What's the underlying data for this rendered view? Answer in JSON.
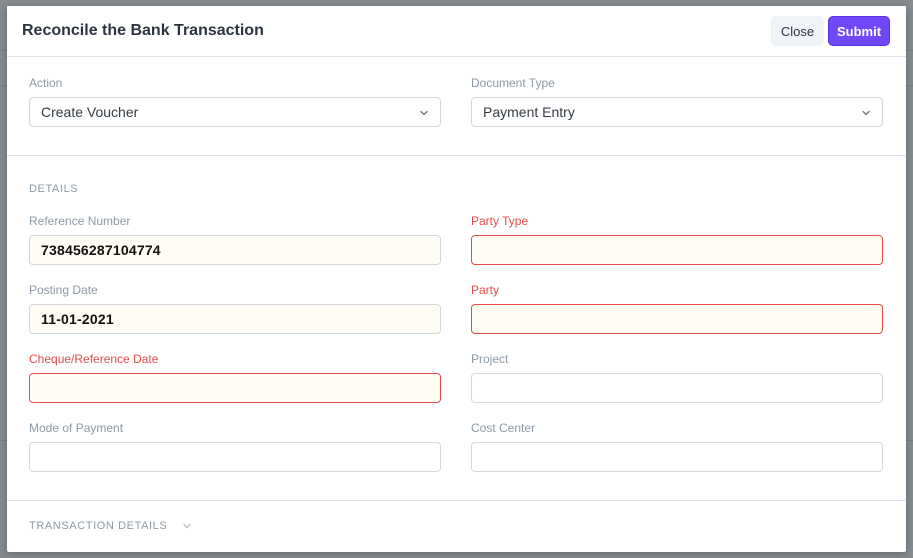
{
  "modal": {
    "title": "Reconcile the Bank Transaction",
    "close_label": "Close",
    "submit_label": "Submit"
  },
  "top_section": {
    "action": {
      "label": "Action",
      "value": "Create Voucher"
    },
    "document_type": {
      "label": "Document Type",
      "value": "Payment Entry"
    }
  },
  "details_section": {
    "heading": "DETAILS",
    "fields": {
      "reference_number": {
        "label": "Reference Number",
        "value": "738456287104774",
        "required": false
      },
      "posting_date": {
        "label": "Posting Date",
        "value": "11-01-2021",
        "required": false
      },
      "cheque_reference_date": {
        "label": "Cheque/Reference Date",
        "value": "",
        "required": true
      },
      "mode_of_payment": {
        "label": "Mode of Payment",
        "value": "",
        "required": false
      },
      "party_type": {
        "label": "Party Type",
        "value": "",
        "required": true
      },
      "party": {
        "label": "Party",
        "value": "",
        "required": true
      },
      "project": {
        "label": "Project",
        "value": "",
        "required": false
      },
      "cost_center": {
        "label": "Cost Center",
        "value": "",
        "required": false
      }
    }
  },
  "transaction_section": {
    "heading": "TRANSACTION DETAILS",
    "collapsed": true
  },
  "colors": {
    "primary": "#7048f6",
    "error": "#e24c4c",
    "label": "#8d99a6",
    "filled_bg": "#fffdf3"
  }
}
